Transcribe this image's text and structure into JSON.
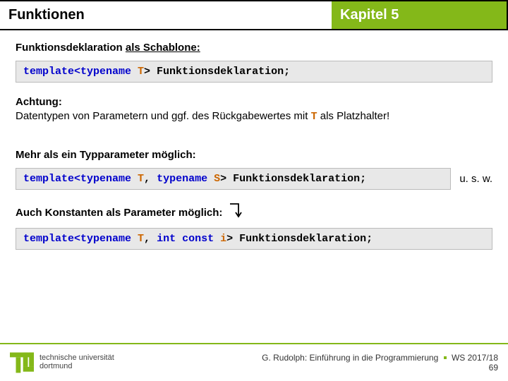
{
  "header": {
    "left": "Funktionen",
    "right": "Kapitel 5"
  },
  "section1": {
    "prefix": "Funktionsdeklaration ",
    "underlined": "als Schablone:"
  },
  "code1": {
    "kw": "template<typename",
    "tp": " T",
    "rest": "> Funktionsdeklaration;"
  },
  "note1": {
    "label": "Achtung:",
    "text_a": "Datentypen von Parametern und ggf. des Rückgabewertes mit ",
    "tp": "T",
    "text_b": " als Platzhalter!"
  },
  "section2": "Mehr als ein Typparameter möglich:",
  "code2": {
    "kw1": "template<typename",
    "tp1": " T",
    "comma1": ", ",
    "kw2": "typename",
    "tp2": " S",
    "rest": "> Funktionsdeklaration;"
  },
  "usw": "u. s. w.",
  "section3": "Auch Konstanten als Parameter möglich:",
  "code3": {
    "kw1": "template<typename",
    "tp1": " T",
    "comma1": ", ",
    "kw2": "int const",
    "tp2": " i",
    "rest": "> Funktionsdeklaration;"
  },
  "footer": {
    "uni1": "technische universität",
    "uni2": "dortmund",
    "credit": "G. Rudolph: Einführung in die Programmierung",
    "term": "WS 2017/18",
    "page": "69"
  }
}
